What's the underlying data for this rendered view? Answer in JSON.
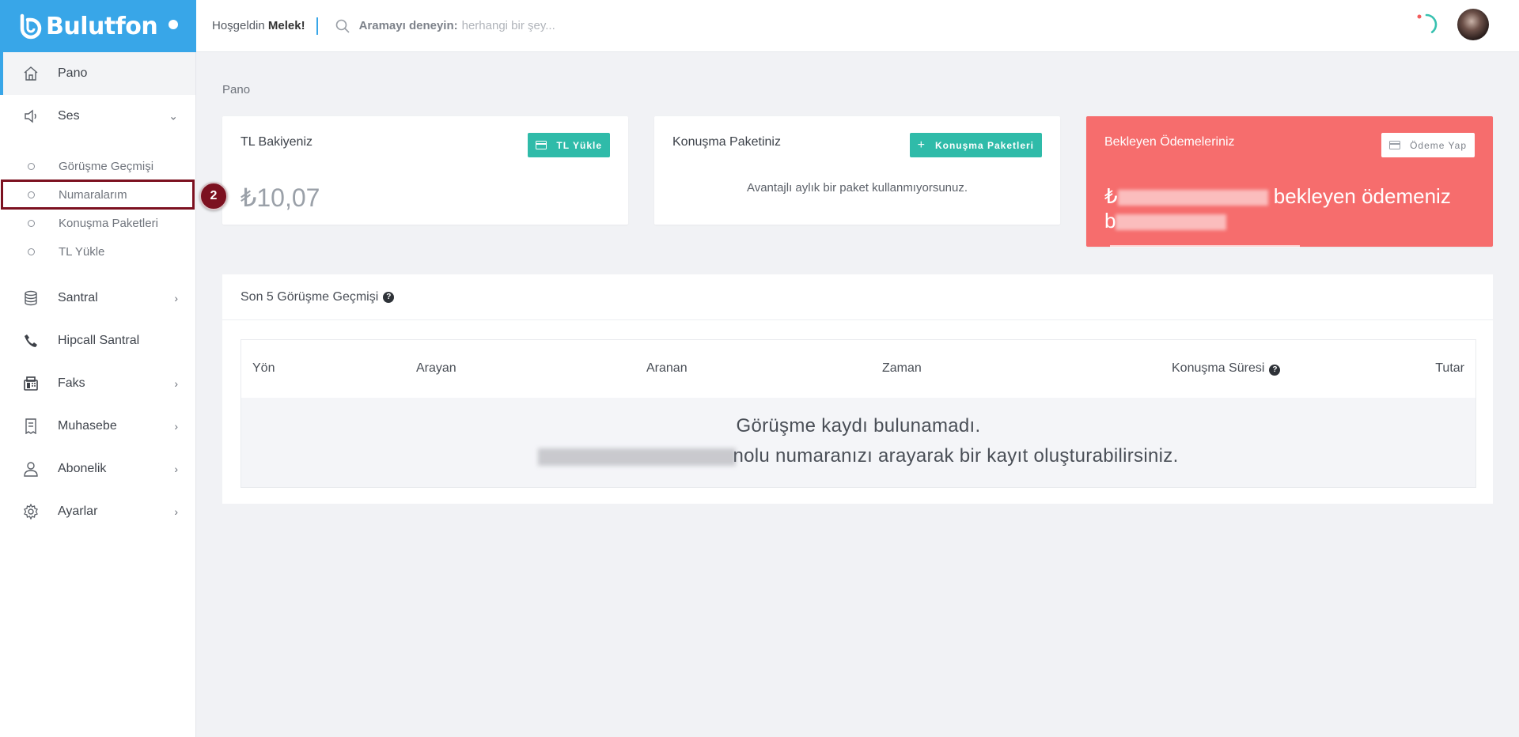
{
  "brand": {
    "name": "Bulutfon",
    "brand_color": "#38a6e8"
  },
  "header": {
    "welcome_prefix": "Hoşgeldin",
    "user_name": "Melek!",
    "search_label": "Aramayı deneyin:",
    "search_placeholder": "herhangi bir şey..."
  },
  "sidebar": {
    "items": [
      {
        "label": "Pano",
        "icon": "home-icon"
      },
      {
        "label": "Ses",
        "icon": "speaker-icon"
      },
      {
        "label": "Santral",
        "icon": "database-icon"
      },
      {
        "label": "Hipcall Santral",
        "icon": "phone-icon"
      },
      {
        "label": "Faks",
        "icon": "fax-icon"
      },
      {
        "label": "Muhasebe",
        "icon": "receipt-icon"
      },
      {
        "label": "Abonelik",
        "icon": "user-icon"
      },
      {
        "label": "Ayarlar",
        "icon": "gear-icon"
      }
    ],
    "ses_sub": [
      {
        "label": "Görüşme Geçmişi"
      },
      {
        "label": "Numaralarım"
      },
      {
        "label": "Konuşma Paketleri"
      },
      {
        "label": "TL Yükle"
      }
    ]
  },
  "annotation": {
    "step": "2",
    "color": "#7c1120"
  },
  "breadcrumb": "Pano",
  "cards": {
    "balance": {
      "title": "TL Bakiyeniz",
      "button": "TL Yükle",
      "amount": "₺10,07"
    },
    "package": {
      "title": "Konuşma Paketiniz",
      "button": "Konuşma Paketleri",
      "empty_text": "Avantajlı aylık bir paket kullanmıyorsunuz."
    },
    "pending": {
      "title": "Bekleyen Ödemeleriniz",
      "button": "Ödeme Yap",
      "text_prefix": "₺",
      "text_visible": "bekleyen ödemeniz",
      "text_line2_prefix": "b",
      "bg_color": "#f66d6d"
    }
  },
  "history": {
    "title": "Son 5 Görüşme Geçmişi",
    "columns": [
      "Yön",
      "Arayan",
      "Aranan",
      "Zaman",
      "Konuşma Süresi",
      "Tutar"
    ],
    "empty_line1": "Görüşme kaydı bulunamadı.",
    "empty_line2": "nolu numaranızı arayarak bir kayıt oluşturabilirsiniz."
  },
  "accent_teal": "#2fbba9"
}
